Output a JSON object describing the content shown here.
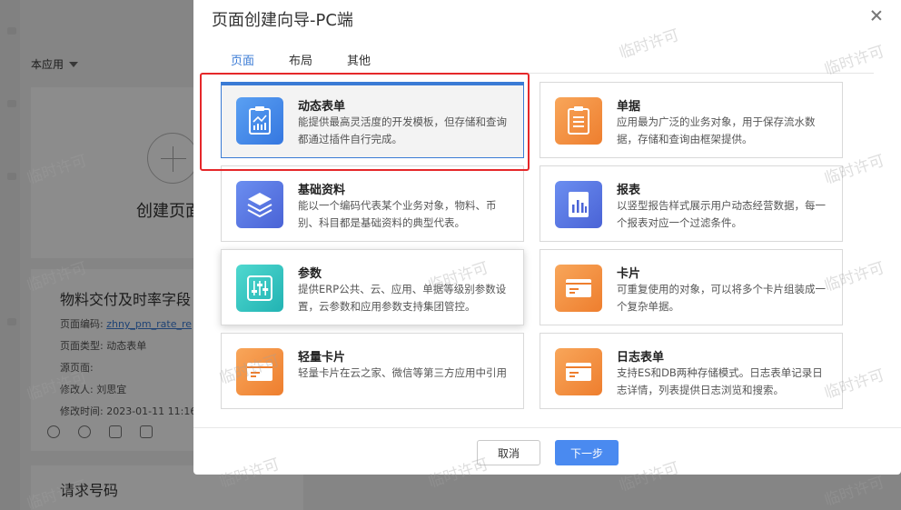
{
  "background": {
    "app_dropdown": "本应用",
    "create_page": "创建页面",
    "card": {
      "title": "物料交付及时率字段",
      "meta": [
        {
          "label": "页面编码: ",
          "value": "zhny_pm_rate_re",
          "link": true
        },
        {
          "label": "页面类型: ",
          "value": "动态表单",
          "link": false
        },
        {
          "label": "源页面: ",
          "value": "",
          "link": false
        },
        {
          "label": "修改人: ",
          "value": "刘思宜",
          "link": false
        },
        {
          "label": "修改时间: ",
          "value": "2023-01-11 11:16",
          "link": false
        }
      ],
      "actions": [
        "eye-icon",
        "share-icon",
        "layout-icon",
        "qrcode-icon"
      ]
    },
    "card2_title": "请求号码"
  },
  "modal": {
    "title": "页面创建向导-PC端",
    "tabs": [
      {
        "label": "页面",
        "active": true
      },
      {
        "label": "布局",
        "active": false
      },
      {
        "label": "其他",
        "active": false
      }
    ],
    "cards": [
      {
        "id": "dynamic-form",
        "title": "动态表单",
        "desc": "能提供最高灵活度的开发模板，但存储和查询都通过插件自行完成。",
        "icon": "chart-clipboard-icon",
        "color": "blue",
        "selected": true
      },
      {
        "id": "bill",
        "title": "单据",
        "desc": "应用最为广泛的业务对象，用于保存流水数据，存储和查询由框架提供。",
        "icon": "clipboard-icon",
        "color": "orange",
        "selected": false
      },
      {
        "id": "basic-data",
        "title": "基础资料",
        "desc": "能以一个编码代表某个业务对象，物料、币别、科目都是基础资料的典型代表。",
        "icon": "layers-icon",
        "color": "indigo",
        "selected": false
      },
      {
        "id": "report",
        "title": "报表",
        "desc": "以竖型报告样式展示用户动态经营数据，每一个报表对应一个过滤条件。",
        "icon": "bar-chart-icon",
        "color": "indigo",
        "selected": false
      },
      {
        "id": "parameter",
        "title": "参数",
        "desc": "提供ERP公共、云、应用、单据等级别参数设置，云参数和应用参数支持集团管控。",
        "icon": "sliders-icon",
        "color": "teal",
        "selected": false,
        "hover": true
      },
      {
        "id": "card",
        "title": "卡片",
        "desc": "可重复使用的对象，可以将多个卡片组装成一个复杂单据。",
        "icon": "card-icon",
        "color": "orange",
        "selected": false
      },
      {
        "id": "light-card",
        "title": "轻量卡片",
        "desc": "轻量卡片在云之家、微信等第三方应用中引用",
        "icon": "card-icon",
        "color": "orange",
        "selected": false
      },
      {
        "id": "log-form",
        "title": "日志表单",
        "desc": "支持ES和DB两种存储模式。日志表单记录日志详情，列表提供日志浏览和搜索。",
        "icon": "card-icon",
        "color": "orange",
        "selected": false
      }
    ],
    "cancel_label": "取消",
    "next_label": "下一步"
  },
  "watermark": "临时许可",
  "colors": {
    "accent": "#3a7bd5",
    "highlight": "#e5282a",
    "primary_button": "#4a8af0"
  }
}
